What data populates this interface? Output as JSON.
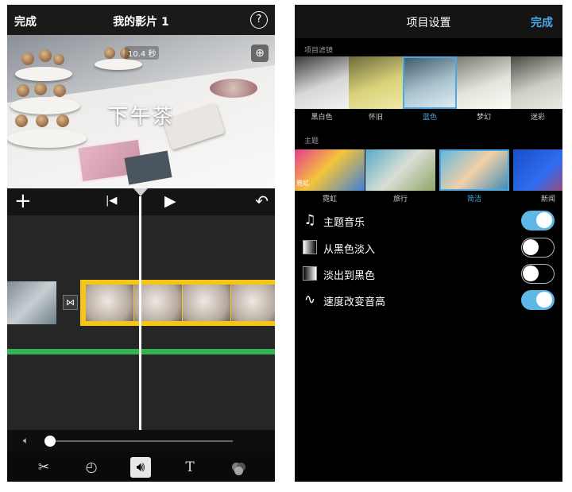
{
  "left": {
    "header": {
      "done_label": "完成",
      "title": "我的影片 1",
      "help_label": "?"
    },
    "preview": {
      "timecode": "10.4 秒",
      "caption": "下午茶",
      "zoom_icon": "zoom-in-icon"
    },
    "timeline_controls": {
      "add_label": "+",
      "skip_icon": "skip-to-start-icon",
      "play_icon": "play-icon",
      "undo_icon": "undo-icon"
    },
    "volume": {
      "icon": "speaker-mute-icon",
      "level": 0.0
    },
    "toolbar": {
      "items": [
        "scissors-icon",
        "speed-icon",
        "volume-icon",
        "text-icon",
        "filter-icon"
      ],
      "active": "volume-icon"
    }
  },
  "right": {
    "header": {
      "title": "项目设置",
      "done_label": "完成"
    },
    "filters": {
      "section_label": "项目滤镜",
      "items": [
        "黑白色",
        "怀旧",
        "蓝色",
        "梦幻",
        "迷彩"
      ],
      "selected": "蓝色"
    },
    "themes": {
      "section_label": "主题",
      "items": [
        "霓虹",
        "旅行",
        "简洁",
        "新闻"
      ],
      "selected": "简洁",
      "thumb_text": "霓虹"
    },
    "options": [
      {
        "icon": "music-note-icon",
        "label": "主题音乐",
        "on": true
      },
      {
        "icon": "fade-in-from-black-icon",
        "label": "从黑色淡入",
        "on": false
      },
      {
        "icon": "fade-out-to-black-icon",
        "label": "淡出到黑色",
        "on": false
      },
      {
        "icon": "waveform-icon",
        "label": "速度改变音高",
        "on": true
      }
    ],
    "accent_color": "#4aa8e6"
  }
}
